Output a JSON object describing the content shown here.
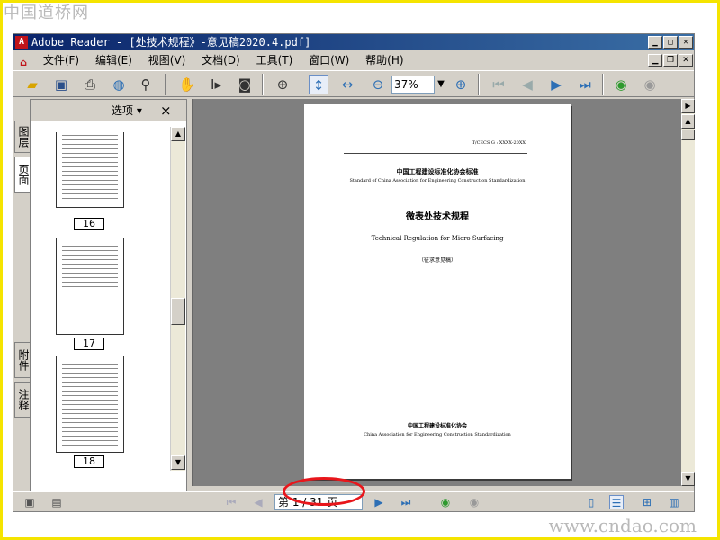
{
  "watermark": {
    "top": "中国道桥网",
    "bottom": "www.cndao.com"
  },
  "window": {
    "title": "Adobe Reader - [处技术规程》-意见稿2020.4.pdf]",
    "buttons": [
      "minimize",
      "maximize",
      "close"
    ]
  },
  "menu": [
    "文件(F)",
    "编辑(E)",
    "视图(V)",
    "文档(D)",
    "工具(T)",
    "窗口(W)",
    "帮助(H)"
  ],
  "toolbar": {
    "zoom_value": "37%",
    "icons": [
      "open-icon",
      "save-icon",
      "print-icon",
      "email-icon",
      "search-icon",
      "hand-icon",
      "select-text-icon",
      "snapshot-icon",
      "zoom-in-icon",
      "fit-page-icon",
      "fit-width-icon",
      "zoom-out-icon",
      "zoom-plus-icon",
      "first-page-icon",
      "prev-page-icon",
      "next-page-icon",
      "last-page-icon",
      "back-icon",
      "forward-icon"
    ]
  },
  "side_tabs": {
    "layers": "图层",
    "pages": "页面",
    "attachments": "附件",
    "comments": "注释"
  },
  "thumb_panel": {
    "options_label": "选项 ▾",
    "close_label": "×",
    "thumbnails": [
      "16",
      "17",
      "18"
    ]
  },
  "document": {
    "code": "T/CECS G : XXXX-20XX",
    "cn_org": "中国工程建设标准化协会标准",
    "en_org": "Standard of China Association for Engineering Construction Standardization",
    "cn_title": "微表处技术规程",
    "en_title": "Technical Regulation for Micro Surfacing",
    "draft": "（征求意见稿）",
    "cn_assoc": "中国工程建设标准化协会",
    "en_assoc": "China Association for Engineering Construction Standardization"
  },
  "statusbar": {
    "page_field": "第 1 / 31 页"
  },
  "colors": {
    "highlight_ellipse": "#e8161b",
    "frame": "#f5e400",
    "doc_background": "#7f7f7f"
  }
}
